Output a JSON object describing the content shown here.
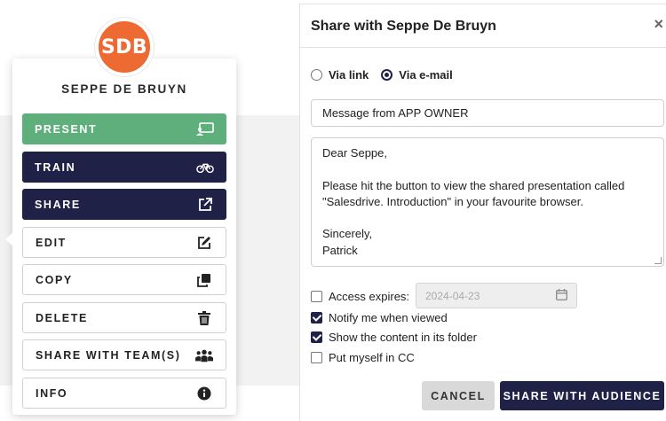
{
  "card": {
    "avatar_initials": "SDB",
    "name": "SEPPE DE BRUYN",
    "menu": [
      {
        "label": "PRESENT",
        "icon": "present-icon",
        "style": "green"
      },
      {
        "label": "TRAIN",
        "icon": "bicycle-icon",
        "style": "navy"
      },
      {
        "label": "SHARE",
        "icon": "external-link-icon",
        "style": "navy"
      },
      {
        "label": "EDIT",
        "icon": "edit-icon",
        "style": "plain"
      },
      {
        "label": "COPY",
        "icon": "copy-icon",
        "style": "plain"
      },
      {
        "label": "DELETE",
        "icon": "trash-icon",
        "style": "plain"
      },
      {
        "label": "SHARE WITH TEAM(S)",
        "icon": "team-icon",
        "style": "plain"
      },
      {
        "label": "INFO",
        "icon": "info-icon",
        "style": "plain"
      }
    ]
  },
  "dialog": {
    "title": "Share with Seppe De Bruyn",
    "close": "×",
    "radio_link": "Via link",
    "radio_email": "Via e-mail",
    "selected_radio": "Via e-mail",
    "subject": "Message from APP OWNER",
    "body_lines": [
      "Dear Seppe,",
      "",
      "Please hit the button to view the shared presentation called",
      "\"Salesdrive. Introduction\" in your favourite browser.",
      "",
      "Sincerely,",
      "Patrick"
    ],
    "access_expires_label": "Access expires:",
    "access_expires_date": "2024-04-23",
    "notify_label": "Notify me when viewed",
    "show_folder_label": "Show the content in its folder",
    "cc_label": "Put myself in CC",
    "cancel_label": "CANCEL",
    "share_label": "SHARE WITH AUDIENCE"
  },
  "colors": {
    "accent_orange": "#ee6a33",
    "navy": "#1f2147",
    "green": "#5faf7d"
  }
}
